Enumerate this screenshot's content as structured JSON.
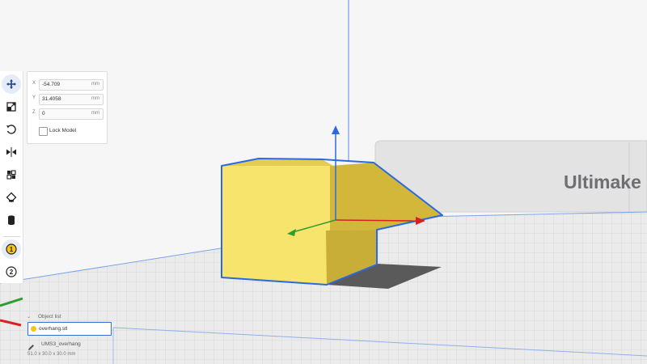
{
  "scene": {
    "brand_text": "Ultimake",
    "model_color": "#f6e46c",
    "selection_color": "#2a6ae0"
  },
  "toolbar": {
    "tools": [
      {
        "id": "move",
        "icon": "move-icon",
        "active": true
      },
      {
        "id": "scale",
        "icon": "scale-icon",
        "active": false
      },
      {
        "id": "rotate",
        "icon": "rotate-icon",
        "active": false
      },
      {
        "id": "mirror",
        "icon": "mirror-icon",
        "active": false
      },
      {
        "id": "per-model-settings",
        "icon": "per-model-settings-icon",
        "active": false
      },
      {
        "id": "support-blocker",
        "icon": "support-blocker-icon",
        "active": false
      },
      {
        "id": "extruder",
        "icon": "extruder-icon",
        "active": false
      },
      {
        "id": "extruder-1",
        "icon": "extruder-1-icon",
        "label": "1",
        "active": true
      },
      {
        "id": "extruder-2",
        "icon": "extruder-2-icon",
        "label": "2",
        "active": false
      }
    ]
  },
  "move_panel": {
    "x": {
      "axis": "X",
      "value": "-54.709",
      "unit": "mm"
    },
    "y": {
      "axis": "Y",
      "value": "31.4058",
      "unit": "mm"
    },
    "z": {
      "axis": "Z",
      "value": "0",
      "unit": "mm"
    },
    "lock_label": "Lock Model",
    "lock_checked": false
  },
  "object_list": {
    "title": "Object list",
    "items": [
      {
        "name": "overhang.stl",
        "color": "#f5c518",
        "selected": true
      }
    ],
    "job_name": "UMS3_overhang",
    "dimensions": "51.0 x 30.0 x 30.0 mm"
  }
}
